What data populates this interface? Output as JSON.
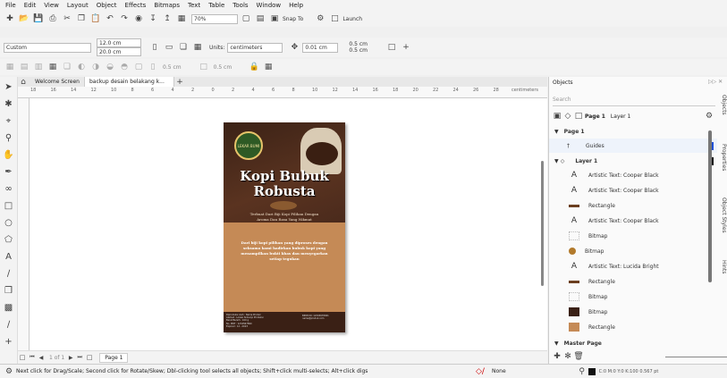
{
  "menu": [
    "File",
    "Edit",
    "View",
    "Layout",
    "Object",
    "Effects",
    "Bitmaps",
    "Text",
    "Table",
    "Tools",
    "Window",
    "Help"
  ],
  "toolbar1": {
    "zoom": "70%",
    "snap": "Snap To",
    "launch": "Launch"
  },
  "toolbar2": {
    "preset": "Custom",
    "width": "12.0 cm",
    "height": "20.0 cm",
    "units_label": "Units:",
    "units": "centimeters",
    "nudge": "0.01 cm",
    "dup_x": "0.5 cm",
    "dup_y": "0.5 cm"
  },
  "toolbar3": {
    "field1": "0.5 cm",
    "field2": "0.5 cm"
  },
  "tabs": {
    "welcome": "Welcome Screen",
    "doc": "backup desain belakang k..."
  },
  "ruler": {
    "ticks": [
      "18",
      "16",
      "14",
      "12",
      "10",
      "8",
      "6",
      "4",
      "2",
      "0",
      "2",
      "4",
      "6",
      "8",
      "10",
      "12",
      "14",
      "16",
      "18",
      "20",
      "22",
      "24",
      "26",
      "28"
    ],
    "unit": "centimeters"
  },
  "poster": {
    "logo": "LEKAR BUMI",
    "title1": "Kopi Bubuk",
    "title2": "Robusta",
    "tagline1": "Terbuat Dari Biji Kopi Pilihan Dengan",
    "tagline2": "Aroma Dan Rasa Yang Nikmat",
    "body1": "Dari biji kopi pilihan yang diproses dengan",
    "body2": "seksama kami hadirkan bubuk kopi yang",
    "body3": "menampilkan bukti khas dan menyegarkan",
    "body4": "setiap tegukan",
    "foot_left": "Diproduksi oleh : Nama Produk\nAlamat : Lokasi Sidoarjo Produksi\nBerat Bersih : 100 g\nNo. PIRT : 1234567890\nExpired : 12 - 2023",
    "foot_right": "BPOM RI: 12345678901\nnama@produk.com"
  },
  "panel": {
    "title": "Objects",
    "search": "Search",
    "page": "Page 1",
    "layer": "Layer 1",
    "page_node": "Page 1",
    "guides": "Guides",
    "layer_node": "Layer 1",
    "master": "Master Page",
    "items": [
      {
        "icon": "A",
        "label": "Artistic Text: Cooper Black"
      },
      {
        "icon": "A",
        "label": "Artistic Text: Cooper Black"
      },
      {
        "icon": "rect",
        "label": "Rectangle"
      },
      {
        "icon": "A",
        "label": "Artistic Text: Cooper Black"
      },
      {
        "icon": "bmp",
        "label": "Bitmap"
      },
      {
        "icon": "bmp2",
        "label": "Bitmap"
      },
      {
        "icon": "A",
        "label": "Artistic Text: Lucida Bright"
      },
      {
        "icon": "rect",
        "label": "Rectangle"
      },
      {
        "icon": "bmp",
        "label": "Bitmap"
      },
      {
        "icon": "bmp3",
        "label": "Bitmap"
      },
      {
        "icon": "rect2",
        "label": "Rectangle"
      }
    ],
    "side_tabs": [
      "Objects",
      "Properties",
      "Object Styles",
      "Hints"
    ]
  },
  "pagebar": {
    "pages": "1 of 1",
    "page": "Page 1"
  },
  "status": {
    "hint": "Next click for Drag/Scale; Second click for Rotate/Skew; Dbl-clicking tool selects all objects; Shift+click multi-selects; Alt+click digs",
    "fill": "None",
    "color": "C:0 M:0 Y:0 K:100  0.567 pt"
  },
  "colors": {
    "poster_dark": "#4a2a1c",
    "poster_orange": "#c58a56",
    "title": "#ffffff",
    "accent": "#d98a35"
  }
}
